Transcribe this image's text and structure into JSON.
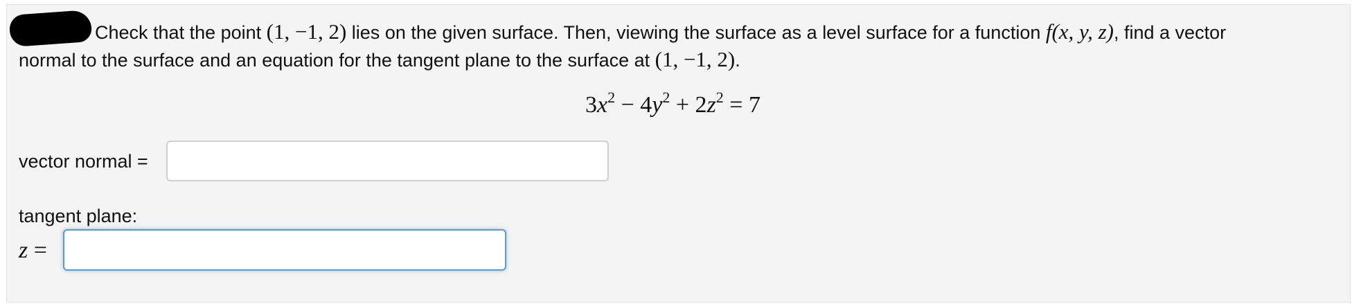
{
  "problem": {
    "line1_text_a": "Check that the point ",
    "point_a": "(1, −1, 2)",
    "line1_text_b": " lies on the given surface. Then, viewing the surface as a level surface for a function ",
    "function": "f(x, y, z)",
    "line1_text_c": ", find a vector",
    "line2_text_a": "normal to the surface and an equation for the tangent plane to the surface at ",
    "point_b": "(1, −1, 2)",
    "line2_text_b": ".",
    "equation": {
      "t1": "3",
      "v1": "x",
      "e1": "2",
      "op1": " − 4",
      "v2": "y",
      "e2": "2",
      "op2": " + 2",
      "v3": "z",
      "e3": "2",
      "rhs": " = 7"
    }
  },
  "answers": {
    "vector_normal_label": "vector normal =",
    "vector_normal_value": "",
    "tangent_plane_label": "tangent plane:",
    "z_var": "z",
    "z_equals": " =",
    "z_value": ""
  },
  "colors": {
    "panel_bg": "#f4f4f4",
    "focus_border": "#5b9bd5",
    "redaction": "#000000"
  }
}
